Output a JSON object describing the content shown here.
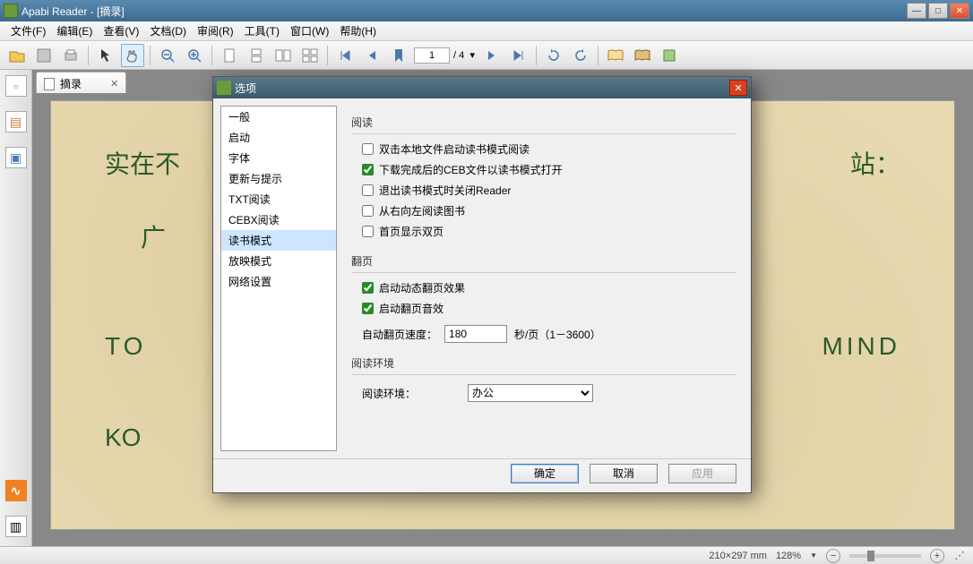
{
  "app_title": "Apabi Reader - [摘录]",
  "menubar": [
    "文件(F)",
    "编辑(E)",
    "查看(V)",
    "文档(D)",
    "审阅(R)",
    "工具(T)",
    "窗口(W)",
    "帮助(H)"
  ],
  "toolbar": {
    "page_current": "1",
    "page_total": "/ 4"
  },
  "doc_tab": {
    "label": "摘录"
  },
  "page_content": {
    "line1_a": "实在不",
    "line1_b": "站：",
    "line2": "广",
    "line3_a": "TO",
    "line3_b": "MIND",
    "line4": "KO"
  },
  "statusbar": {
    "page_size": "210×297 mm",
    "zoom": "128%"
  },
  "dialog": {
    "title": "选项",
    "categories": [
      "一般",
      "启动",
      "字体",
      "更新与提示",
      "TXT阅读",
      "CEBX阅读",
      "读书模式",
      "放映模式",
      "网络设置"
    ],
    "selected_index": 6,
    "group_reading": "阅读",
    "chk_double_click": {
      "label": "双击本地文件启动读书模式阅读",
      "checked": false
    },
    "chk_ceb_open": {
      "label": "下载完成后的CEB文件以读书模式打开",
      "checked": true
    },
    "chk_close_reader": {
      "label": "退出读书模式时关闭Reader",
      "checked": false
    },
    "chk_rtl": {
      "label": "从右向左阅读图书",
      "checked": false
    },
    "chk_first_double": {
      "label": "首页显示双页",
      "checked": false
    },
    "group_pageturn": "翻页",
    "chk_anim": {
      "label": "启动动态翻页效果",
      "checked": true
    },
    "chk_sound": {
      "label": "启动翻页音效",
      "checked": true
    },
    "auto_speed_label": "自动翻页速度：",
    "auto_speed_value": "180",
    "auto_speed_unit": "秒/页（1－3600）",
    "group_env": "阅读环境",
    "env_label": "阅读环境：",
    "env_value": "办公",
    "btn_ok": "确定",
    "btn_cancel": "取消",
    "btn_apply": "应用"
  }
}
